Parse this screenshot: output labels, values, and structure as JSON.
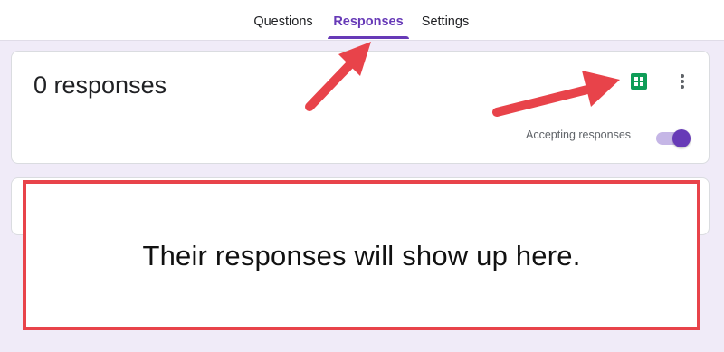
{
  "tabs": [
    {
      "label": "Questions",
      "active": false
    },
    {
      "label": "Responses",
      "active": true
    },
    {
      "label": "Settings",
      "active": false
    }
  ],
  "summary": {
    "count_text": "0 responses",
    "accepting_label": "Accepting responses",
    "accepting_on": true
  },
  "icons": {
    "sheets": "google-sheets-icon",
    "more": "more-vert-icon"
  },
  "callout": {
    "text": "Their responses will show up here."
  },
  "colors": {
    "accent": "#673ab7",
    "background": "#f0ebf8",
    "annotation": "#e8434a",
    "sheets_green": "#0f9d58"
  }
}
